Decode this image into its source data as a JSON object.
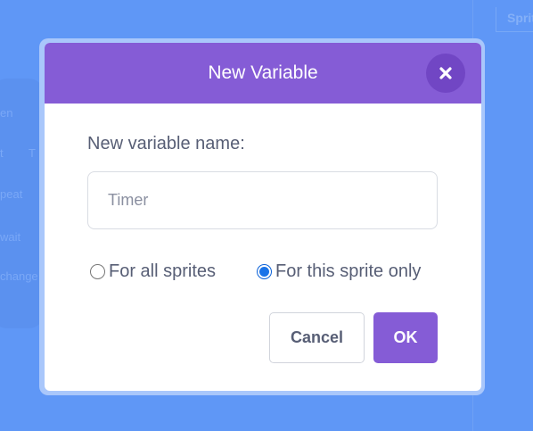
{
  "dialog": {
    "title": "New Variable",
    "close_icon": "close-icon",
    "field_label": "New variable name:",
    "input": {
      "value": "",
      "placeholder": "Timer"
    },
    "scope_options": [
      {
        "label": "For all sprites",
        "checked": false
      },
      {
        "label": "For this sprite only",
        "checked": true
      }
    ],
    "buttons": {
      "cancel": "Cancel",
      "ok": "OK"
    }
  },
  "background": {
    "block_fragments": [
      "en",
      "t",
      "T",
      "peat",
      "wait",
      "change"
    ],
    "right_tab": "Sprit"
  },
  "colors": {
    "backdrop": "#5f97f6",
    "header": "#855cd6",
    "close_button": "#7146c4",
    "ok_button": "#855cd6",
    "text": "#575e75"
  }
}
